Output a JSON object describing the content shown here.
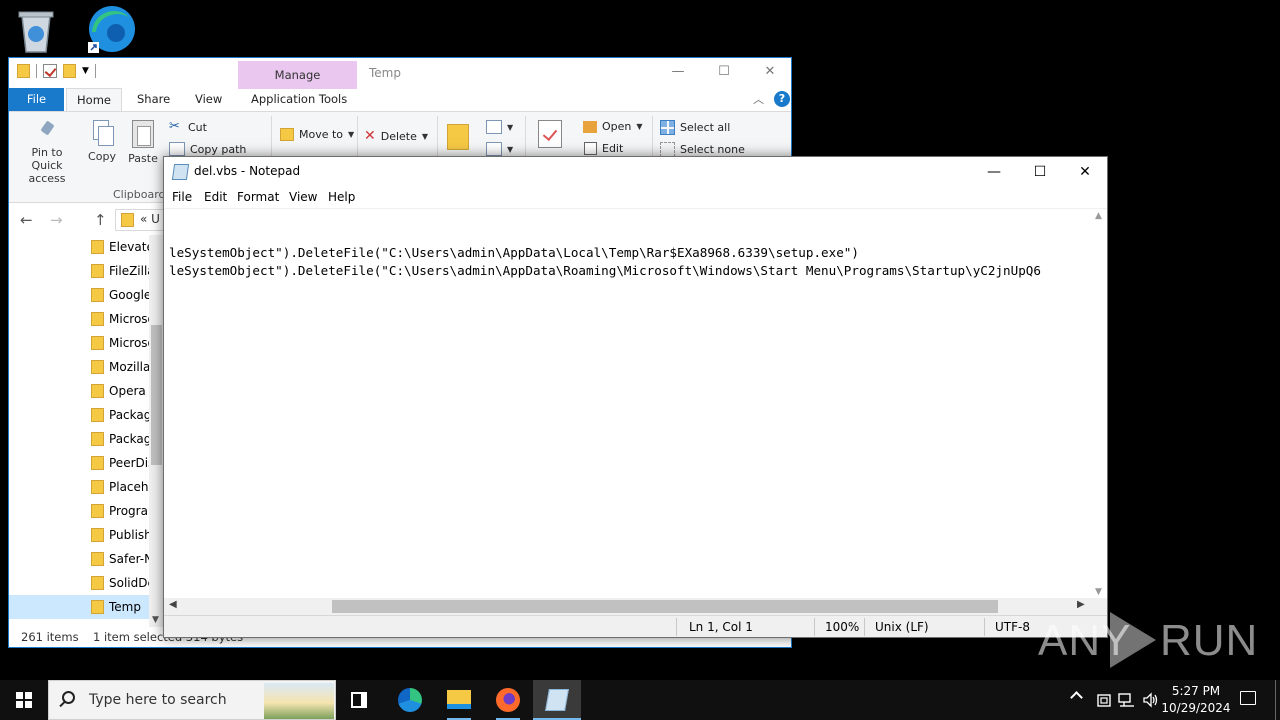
{
  "explorer": {
    "title": "Temp",
    "manage_tab": "Manage",
    "tabs": {
      "file": "File",
      "home": "Home",
      "share": "Share",
      "view": "View",
      "app_tools": "Application Tools"
    },
    "help": "?",
    "ribbon": {
      "pin": "Pin to Quick access",
      "copy": "Copy",
      "paste": "Paste",
      "cut": "Cut",
      "copy_path": "Copy path",
      "clipboard_group": "Clipboard",
      "move_to": "Move to",
      "delete": "Delete",
      "open": "Open",
      "edit": "Edit",
      "select_all": "Select all",
      "select_none": "Select none"
    },
    "address_crumb": "«  U",
    "nav_items": [
      {
        "label": "Elevate",
        "selected": false
      },
      {
        "label": "FileZilla",
        "selected": false
      },
      {
        "label": "Google",
        "selected": false
      },
      {
        "label": "Microso",
        "selected": false
      },
      {
        "label": "Microso",
        "selected": false
      },
      {
        "label": "Mozilla",
        "selected": false
      },
      {
        "label": "Opera",
        "selected": false
      },
      {
        "label": "Packag",
        "selected": false
      },
      {
        "label": "Packag",
        "selected": false
      },
      {
        "label": "PeerDis",
        "selected": false
      },
      {
        "label": "Placeho",
        "selected": false
      },
      {
        "label": "Prograr",
        "selected": false
      },
      {
        "label": "Publish",
        "selected": false
      },
      {
        "label": "Safer-N",
        "selected": false
      },
      {
        "label": "SolidDc",
        "selected": false
      },
      {
        "label": "Temp",
        "selected": true
      }
    ],
    "status": {
      "items": "261 items",
      "selected": "1 item selected  314 bytes"
    }
  },
  "notepad": {
    "title": "del.vbs - Notepad",
    "menu": {
      "file": "File",
      "edit": "Edit",
      "format": "Format",
      "view": "View",
      "help": "Help"
    },
    "lines": [
      "leSystemObject\").DeleteFile(\"C:\\Users\\admin\\AppData\\Local\\Temp\\Rar$EXa8968.6339\\setup.exe\")",
      "leSystemObject\").DeleteFile(\"C:\\Users\\admin\\AppData\\Roaming\\Microsoft\\Windows\\Start Menu\\Programs\\Startup\\yC2jnUpQ6"
    ],
    "status": {
      "position": "Ln 1, Col 1",
      "zoom": "100%",
      "line_ending": "Unix (LF)",
      "encoding": "UTF-8"
    }
  },
  "watermark": {
    "left": "ANY",
    "right": "RUN"
  },
  "taskbar": {
    "search_placeholder": "Type here to search",
    "time": "5:27 PM",
    "date": "10/29/2024"
  },
  "colors": {
    "accent": "#1979ca",
    "manage_tab": "#e9c7ef",
    "taskbar": "#101010"
  }
}
